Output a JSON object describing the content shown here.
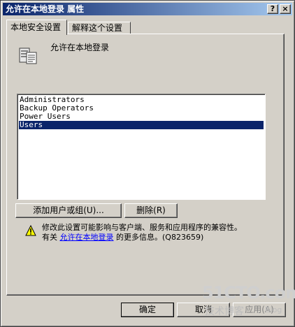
{
  "window": {
    "title": "允许在本地登录 属性"
  },
  "titlebar_buttons": {
    "help": "?",
    "close": "×"
  },
  "tabs": [
    {
      "label": "本地安全设置"
    },
    {
      "label": "解释这个设置"
    }
  ],
  "policy": {
    "name": "允许在本地登录"
  },
  "users_list": {
    "items": [
      "Administrators",
      "Backup Operators",
      "Power Users",
      "Users"
    ],
    "selected_index": 3
  },
  "buttons": {
    "add": "添加用户或组(U)...",
    "remove": "删除(R)"
  },
  "warning": {
    "line1": "修改此设置可能影响与客户端、服务和应用程序的兼容性。",
    "line2_prefix": "有关",
    "link_text": "允许在本地登录",
    "line2_suffix": "的更多信息。(Q823659)"
  },
  "dialog_buttons": {
    "ok": "确定",
    "cancel": "取消",
    "apply": "应用(A)"
  },
  "watermark": {
    "site": "51CTO.com",
    "sub": "技术博客",
    "blog": "Blog"
  },
  "colors": {
    "selection": "#0a246a",
    "face": "#d4d0c8",
    "link": "#0000ff"
  }
}
